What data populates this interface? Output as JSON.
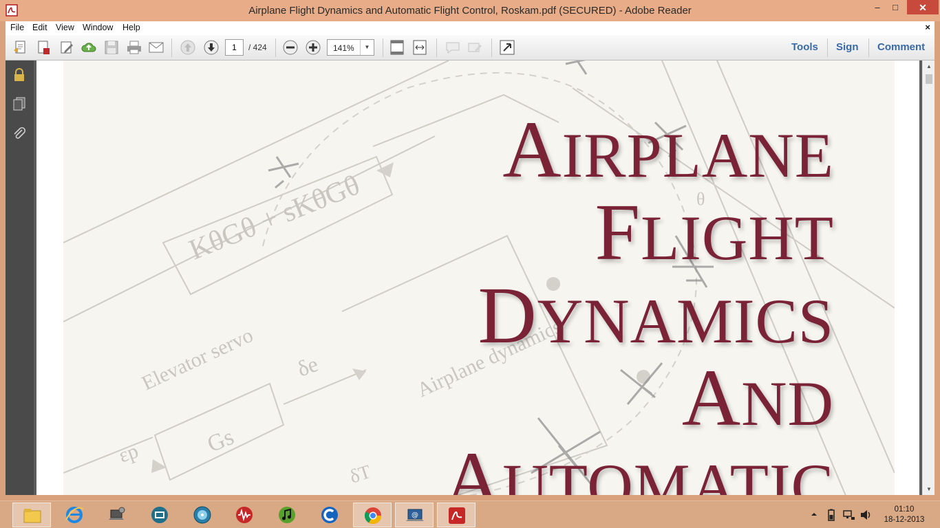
{
  "window": {
    "title": "Airplane Flight Dynamics and Automatic Flight Control, Roskam.pdf (SECURED) - Adobe Reader",
    "minimize": "–",
    "maximize": "□",
    "close": "✕"
  },
  "menu": {
    "items": [
      "File",
      "Edit",
      "View",
      "Window",
      "Help"
    ],
    "close_doc": "×"
  },
  "toolbar": {
    "page_current": "1",
    "page_total": "/ 424",
    "zoom": "141%",
    "zoom_arrow": "▼",
    "tools_label": "Tools",
    "sign_label": "Sign",
    "comment_label": "Comment"
  },
  "cover": {
    "title_lines": [
      {
        "cap": "A",
        "rest": "IRPLANE"
      },
      {
        "cap": "F",
        "rest": "LIGHT"
      },
      {
        "cap": "D",
        "rest": "YNAMICS"
      },
      {
        "cap": "A",
        "rest": "ND"
      },
      {
        "cap": "A",
        "rest": "UTOMATIC"
      }
    ],
    "diagram_labels": {
      "controller": "KθGθ + sKθGθ",
      "servo": "Elevator servo",
      "servo_tf": "Gs",
      "airplane": "Airplane dynamics",
      "delta_e": "δe",
      "epsilon": "εp",
      "delta_t": "δT",
      "theta": "θ"
    }
  },
  "scrollbar": {
    "up": "▲",
    "down": "▼"
  },
  "taskbar": {
    "apps": [
      "file-explorer",
      "internet-explorer",
      "laptop-settings",
      "media-player",
      "dvd-player",
      "audio-app",
      "itunes",
      "cyberlink-app",
      "chrome",
      "email-app",
      "adobe-reader"
    ],
    "clock_time": "01:10",
    "clock_date": "18-12-2013"
  },
  "colors": {
    "title_bar": "#e8ad88",
    "close_button": "#c74a3c",
    "cover_title": "#7a2236",
    "link_blue": "#3a6aa6"
  }
}
